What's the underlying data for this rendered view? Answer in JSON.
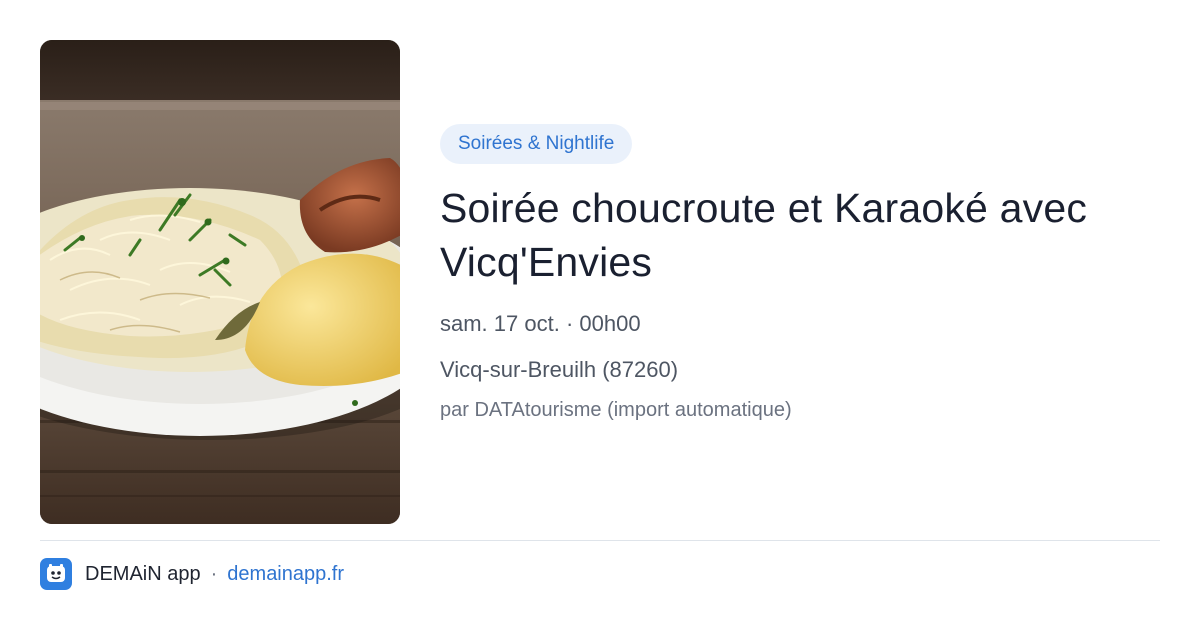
{
  "event": {
    "category": "Soirées & Nightlife",
    "title": "Soirée choucroute et Karaoké avec Vicq'Envies",
    "date": "sam. 17 oct. · 00h00",
    "location": "Vicq-sur-Breuilh (87260)",
    "author": "par DATAtourisme (import automatique)",
    "image_icon": "sauerkraut-dish-photo"
  },
  "footer": {
    "app_name": "DEMAiN app",
    "separator": "·",
    "url": "demainapp.fr",
    "logo_icon": "demain-app-logo-icon"
  },
  "colors": {
    "accent": "#2f74d0",
    "chip_bg": "#eaf1fb",
    "title": "#1a2030",
    "text": "#4e5663",
    "muted": "#6b7280",
    "divider": "#dfe4ea"
  }
}
